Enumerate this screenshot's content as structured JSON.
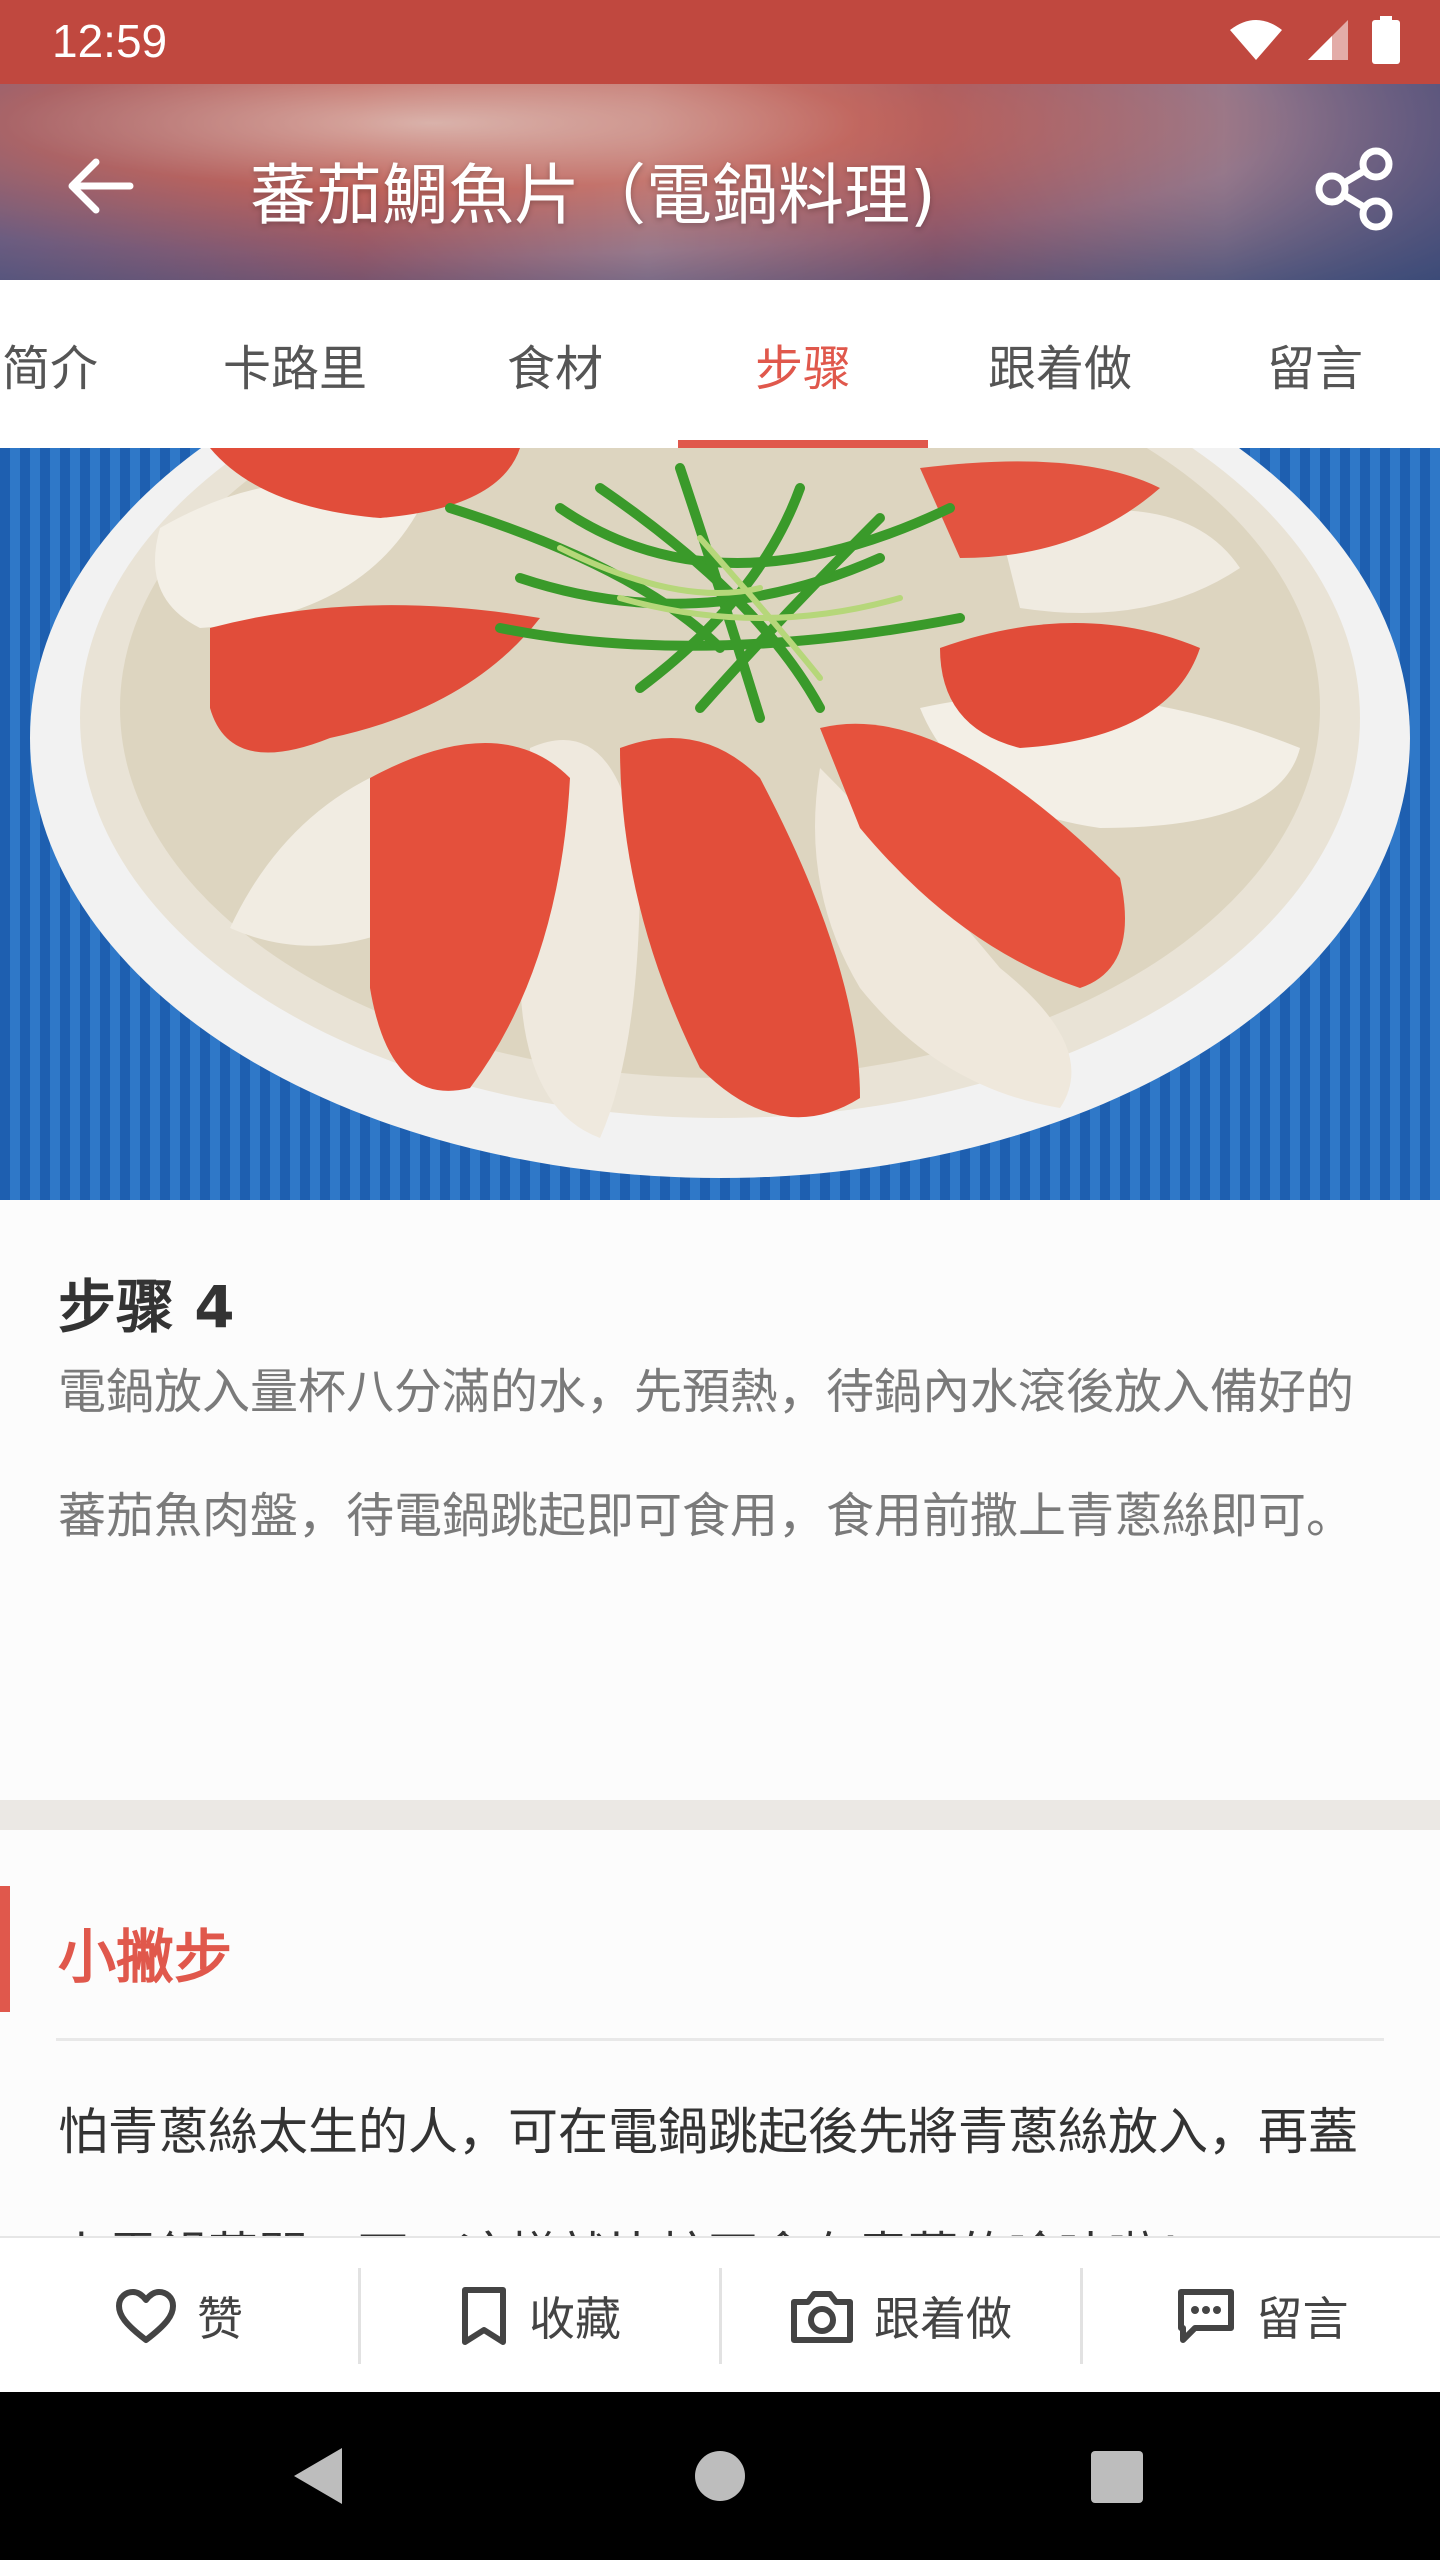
{
  "status": {
    "time": "12:59"
  },
  "header": {
    "title": "蕃茄鯛魚片（電鍋料理)"
  },
  "tabs": [
    {
      "label": "简介"
    },
    {
      "label": "卡路里"
    },
    {
      "label": "食材"
    },
    {
      "label": "步骤"
    },
    {
      "label": "跟着做"
    },
    {
      "label": "留言"
    }
  ],
  "step": {
    "title": "步骤 4",
    "text": "電鍋放入量杯八分滿的水，先預熱，待鍋內水滾後放入備好的蕃茄魚肉盤，待電鍋跳起即可食用，食用前撒上青蔥絲即可。"
  },
  "tips": {
    "title": "小撇步",
    "text": "怕青蔥絲太生的人，可在電鍋跳起後先將青蔥絲放入，再蓋上電鍋蓋悶一下，這樣就比較不會有青蔥的嗆味啦！"
  },
  "actions": [
    {
      "label": "赞",
      "icon": "heart-icon"
    },
    {
      "label": "收藏",
      "icon": "bookmark-icon"
    },
    {
      "label": "跟着做",
      "icon": "camera-icon"
    },
    {
      "label": "留言",
      "icon": "comment-icon"
    }
  ],
  "colors": {
    "accent": "#e0584c",
    "statusbar": "#c0483f"
  }
}
